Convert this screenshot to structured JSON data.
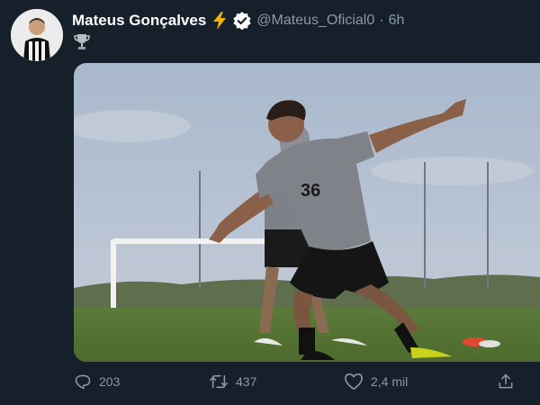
{
  "tweet": {
    "author_name": "Mateus Gonçalves",
    "handle": "@Mateus_Oficial0",
    "separator": "·",
    "time": "6h",
    "media": {
      "jersey_number": "36"
    }
  },
  "actions": {
    "replies": "203",
    "retweets": "437",
    "likes": "2,4 mil"
  },
  "icons": {
    "bolt": "high-voltage-emoji",
    "verified": "verified-badge",
    "trophy": "trophy-emoji",
    "reply": "reply-icon",
    "retweet": "retweet-icon",
    "like": "heart-icon",
    "share": "share-icon"
  },
  "colors": {
    "background": "#15202b",
    "name": "#ffffff",
    "secondary_text": "#8b98a5",
    "bolt": "#f5b400",
    "verified_badge": "#ffffff"
  }
}
